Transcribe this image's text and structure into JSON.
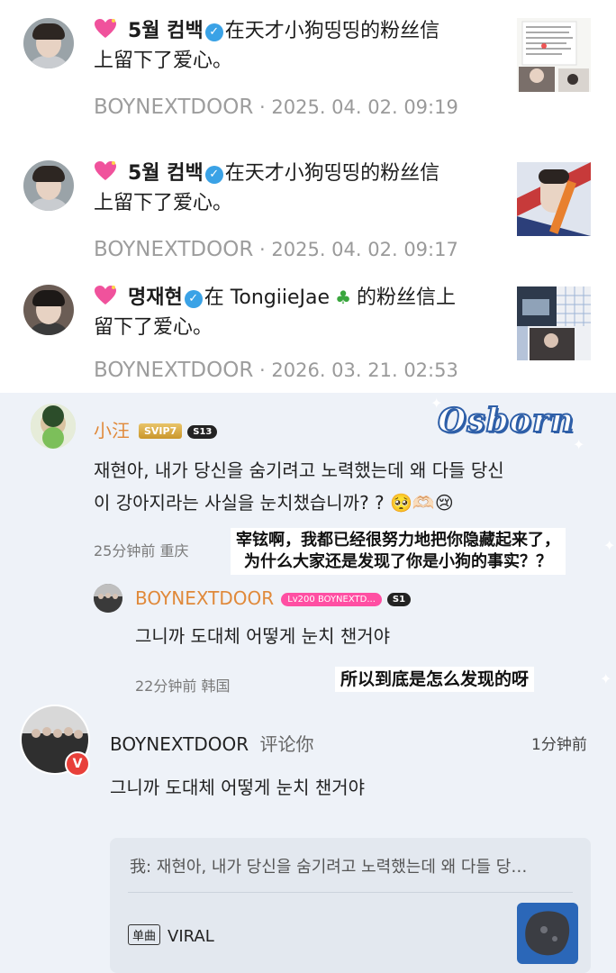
{
  "notifications": [
    {
      "user": "5월 컴백",
      "message_line1": "在天才小狗띵띵的粉丝信",
      "message_line2": "上留下了爱心。",
      "source": "BOYNEXTDOOR",
      "time": "2025. 04. 02. 09:19"
    },
    {
      "user": "5월 컴백",
      "message_line1": "在天才小狗띵띵的粉丝信",
      "message_line2": "上留下了爱心。",
      "source": "BOYNEXTDOOR",
      "time": "2025. 04. 02. 09:17"
    },
    {
      "user": "명재현",
      "message_pre": "在 TongiieJae",
      "message_post": "的粉丝信上",
      "message_line2": "留下了爱心。",
      "source": "BOYNEXTDOOR",
      "time": "2026. 03. 21. 02:53"
    }
  ],
  "separator_dot": "·",
  "comments": {
    "first": {
      "username": "小汪",
      "vip_badge": "SVIP7",
      "level_badge": "S13",
      "text_line1": "재현아, 내가 당신을 숨기려고 노력했는데 왜 다들 당신",
      "text_line2": "이 강아지라는 사실을 눈치챘습니까? ? 🥺🫶🏻😢",
      "time": "25分钟前 重庆",
      "translation_line1": "宰铉啊，我都已经很努力地把你隐藏起来了，",
      "translation_line2": "为什么大家还是发现了你是小狗的事实？？"
    },
    "reply": {
      "username": "BOYNEXTDOOR",
      "level_badge": "Lv200 BOYNEXTD...",
      "s_badge": "S1",
      "text": "그니까 도대체 어떻게 눈치 챈거야",
      "time": "22分钟前 韩国",
      "translation": "所以到底是怎么发现的呀"
    },
    "notice": {
      "username": "BOYNEXTDOOR",
      "action": "评论你",
      "time": "1分钟前",
      "text": "그니까 도대체 어떻게 눈치 챈거야",
      "quote": "我: 재현아, 내가 당신을 숨기려고 노력했는데 왜 다들 당…",
      "song_tag": "单曲",
      "song_name": "VIRAL"
    }
  },
  "watermark": "Osborn",
  "colors": {
    "accent_orange": "#e0893a",
    "verified_blue": "#3aa2e6",
    "panel_bg": "#eef2f8",
    "meta_gray": "#9a9a9a"
  }
}
